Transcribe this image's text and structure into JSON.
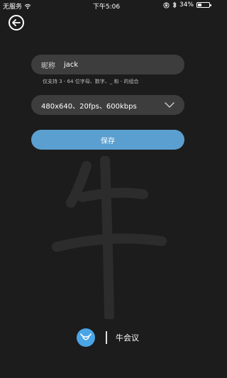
{
  "status_bar": {
    "carrier": "无服务",
    "time": "下午5:06",
    "battery": "34%",
    "battery_level": 0.34
  },
  "back": {
    "icon": "arrow-left-circle-icon"
  },
  "nickname": {
    "label": "昵称",
    "value": "jack",
    "hint": "仅支持 3 - 64 位字母、数字、_ 和 - 的组合"
  },
  "resolution": {
    "selected": "480x640、20fps、600kbps",
    "icon": "chevron-down-icon"
  },
  "save_label": "保存",
  "brand": {
    "name": "牛会议",
    "logo_icon": "bull-logo-icon",
    "watermark": "牛"
  },
  "colors": {
    "background": "#1c1c1c",
    "field": "#3d3d3d",
    "accent": "#5b9fd0",
    "logo": "#4aa5e6"
  }
}
